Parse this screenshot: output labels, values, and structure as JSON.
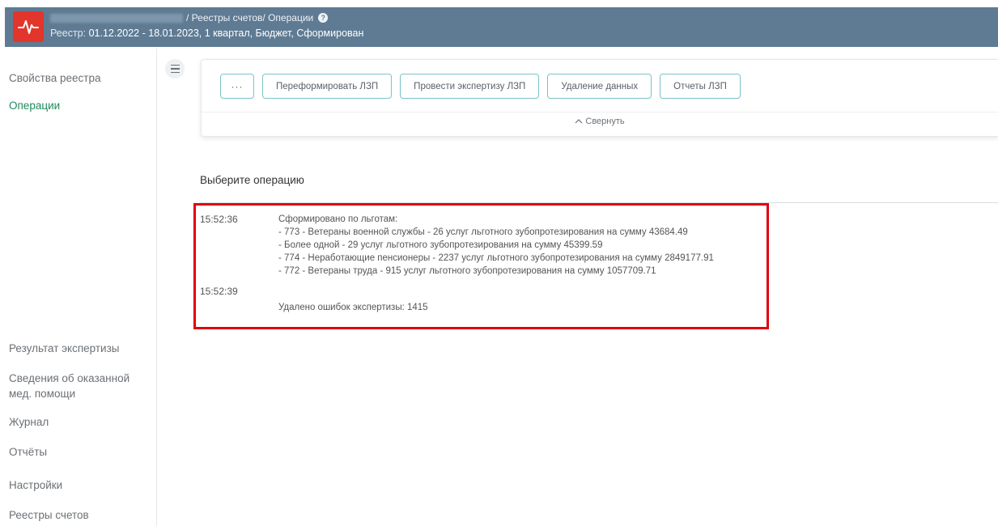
{
  "header": {
    "breadcrumb_suffix": "/ Реестры счетов/ Операции",
    "registry_label": "Реестр:",
    "registry_value": "01.12.2022 - 18.01.2023, 1 квартал, Бюджет, Сформирован"
  },
  "sidebar": {
    "items": [
      {
        "label": "Свойства реестра"
      },
      {
        "label": "Операции"
      },
      {
        "label": "Результат экспертизы"
      },
      {
        "label": "Сведения об оказанной\nмед. помощи"
      },
      {
        "label": "Журнал"
      },
      {
        "label": "Отчёты"
      },
      {
        "label": "Настройки"
      },
      {
        "label": "Реестры счетов"
      }
    ]
  },
  "ops": {
    "more_label": "···",
    "buttons": [
      {
        "label": "Переформировать ЛЗП"
      },
      {
        "label": "Провести экспертизу ЛЗП"
      },
      {
        "label": "Удаление данных"
      },
      {
        "label": "Отчеты ЛЗП"
      }
    ],
    "collapse_label": "Свернуть"
  },
  "main": {
    "choose_title": "Выберите операцию"
  },
  "log": [
    {
      "time": "15:52:36",
      "lines": [
        "Сформировано по льготам:",
        "- 773 - Ветераны военной службы - 26 услуг льготного зубопротезирования на сумму 43684.49",
        "- Более одной - 29 услуг льготного зубопротезирования на сумму 45399.59",
        "- 774 - Неработающие пенсионеры - 2237 услуг льготного зубопротезирования на сумму 2849177.91",
        "- 772 - Ветераны труда - 915 услуг льготного зубопротезирования на сумму 1057709.71"
      ]
    },
    {
      "time": "15:52:39",
      "lines": [
        "Удалено ошибок экспертизы: 1415"
      ]
    }
  ],
  "colors": {
    "header_bg": "#5f7b93",
    "logo_bg": "#e2352b",
    "active_nav": "#1e8a5b",
    "button_border": "#7bc3c8",
    "highlight_border": "#e1000f"
  },
  "icons": {
    "logo": "heartbeat-icon",
    "help": "question-circle-icon",
    "menu": "hamburger-icon",
    "collapse": "chevron-up-icon"
  }
}
